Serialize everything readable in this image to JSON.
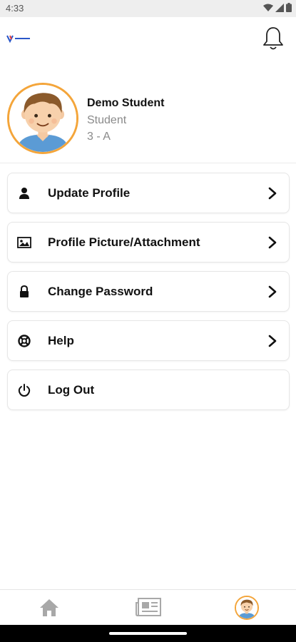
{
  "status_bar": {
    "time": "4:33"
  },
  "profile": {
    "name": "Demo Student",
    "role": "Student",
    "class": "3 - A"
  },
  "menu": {
    "items": [
      {
        "label": "Update Profile",
        "icon": "person-icon",
        "has_chevron": true
      },
      {
        "label": "Profile Picture/Attachment",
        "icon": "image-icon",
        "has_chevron": true
      },
      {
        "label": "Change Password",
        "icon": "lock-icon",
        "has_chevron": true
      },
      {
        "label": "Help",
        "icon": "lifebuoy-icon",
        "has_chevron": true
      },
      {
        "label": "Log Out",
        "icon": "power-icon",
        "has_chevron": false
      }
    ]
  },
  "bottom_nav": {
    "items": [
      "home-icon",
      "newspaper-icon",
      "profile-avatar"
    ],
    "active": "profile-avatar"
  },
  "colors": {
    "accent_orange": "#f4a53a",
    "text_primary": "#111111",
    "text_secondary": "#8a8a8a",
    "status_bar_bg": "#eeeeee"
  }
}
